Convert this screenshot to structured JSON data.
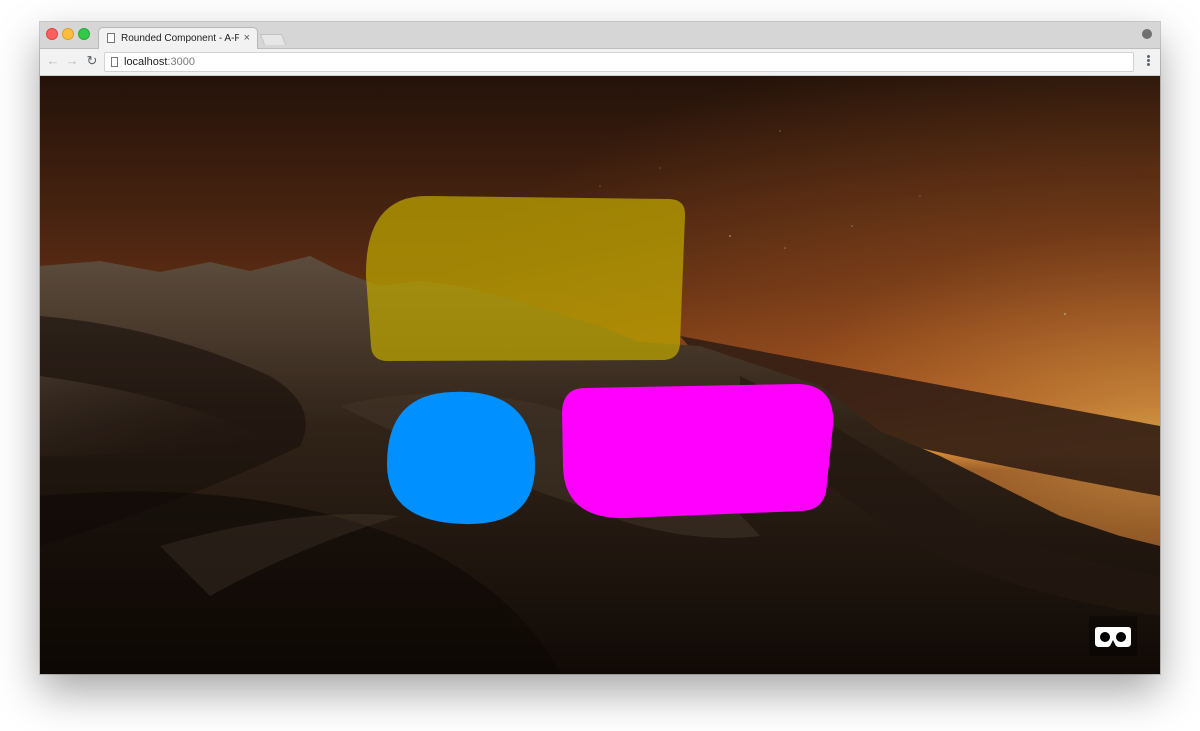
{
  "browser": {
    "tab_title": "Rounded Component - A-Frame",
    "tab_close": "×",
    "url_host": "localhost",
    "url_port": ":3000"
  },
  "scene": {
    "shapes": [
      {
        "name": "yellow-rounded-rect",
        "color": "#bfa700",
        "opacity": 0.72
      },
      {
        "name": "blue-rounded-square",
        "color": "#0090ff",
        "opacity": 1
      },
      {
        "name": "magenta-rounded-rect",
        "color": "#ff00ff",
        "opacity": 1
      }
    ]
  },
  "colors": {
    "sky_glow": "#ff9b3a",
    "terrain_dark": "#1a100a"
  },
  "icons": {
    "vr": "vr-goggles-icon"
  }
}
